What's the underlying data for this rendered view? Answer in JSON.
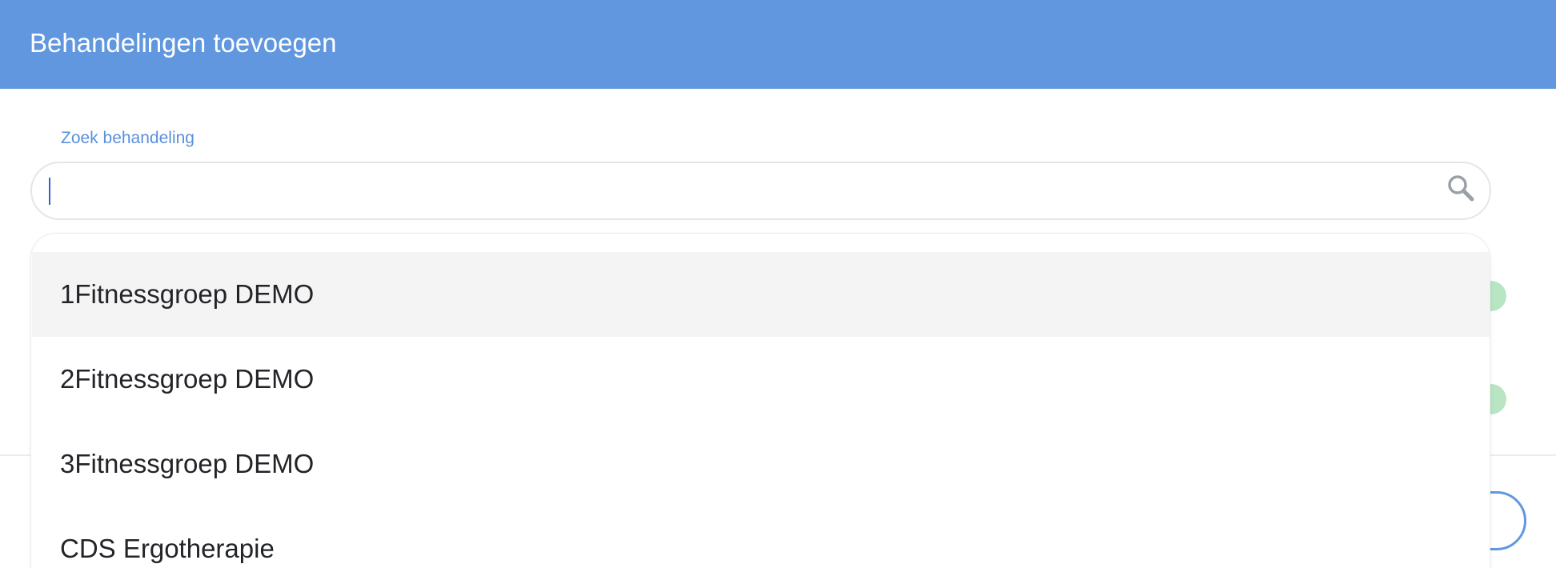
{
  "header": {
    "title": "Behandelingen toevoegen"
  },
  "search": {
    "label": "Zoek behandeling",
    "value": "",
    "placeholder": "",
    "icon": "search-icon"
  },
  "dropdown": {
    "options": [
      {
        "label": "1Fitnessgroep DEMO",
        "highlighted": true
      },
      {
        "label": "2Fitnessgroep DEMO",
        "highlighted": false
      },
      {
        "label": "3Fitnessgroep DEMO",
        "highlighted": false
      },
      {
        "label": "CDS Ergotherapie",
        "highlighted": false
      }
    ]
  },
  "colors": {
    "header_bg": "#6097df",
    "label_text": "#5a90dc",
    "highlight_bg": "#f4f4f4",
    "option_text": "#222428",
    "status_green": "#b8e5c3"
  }
}
